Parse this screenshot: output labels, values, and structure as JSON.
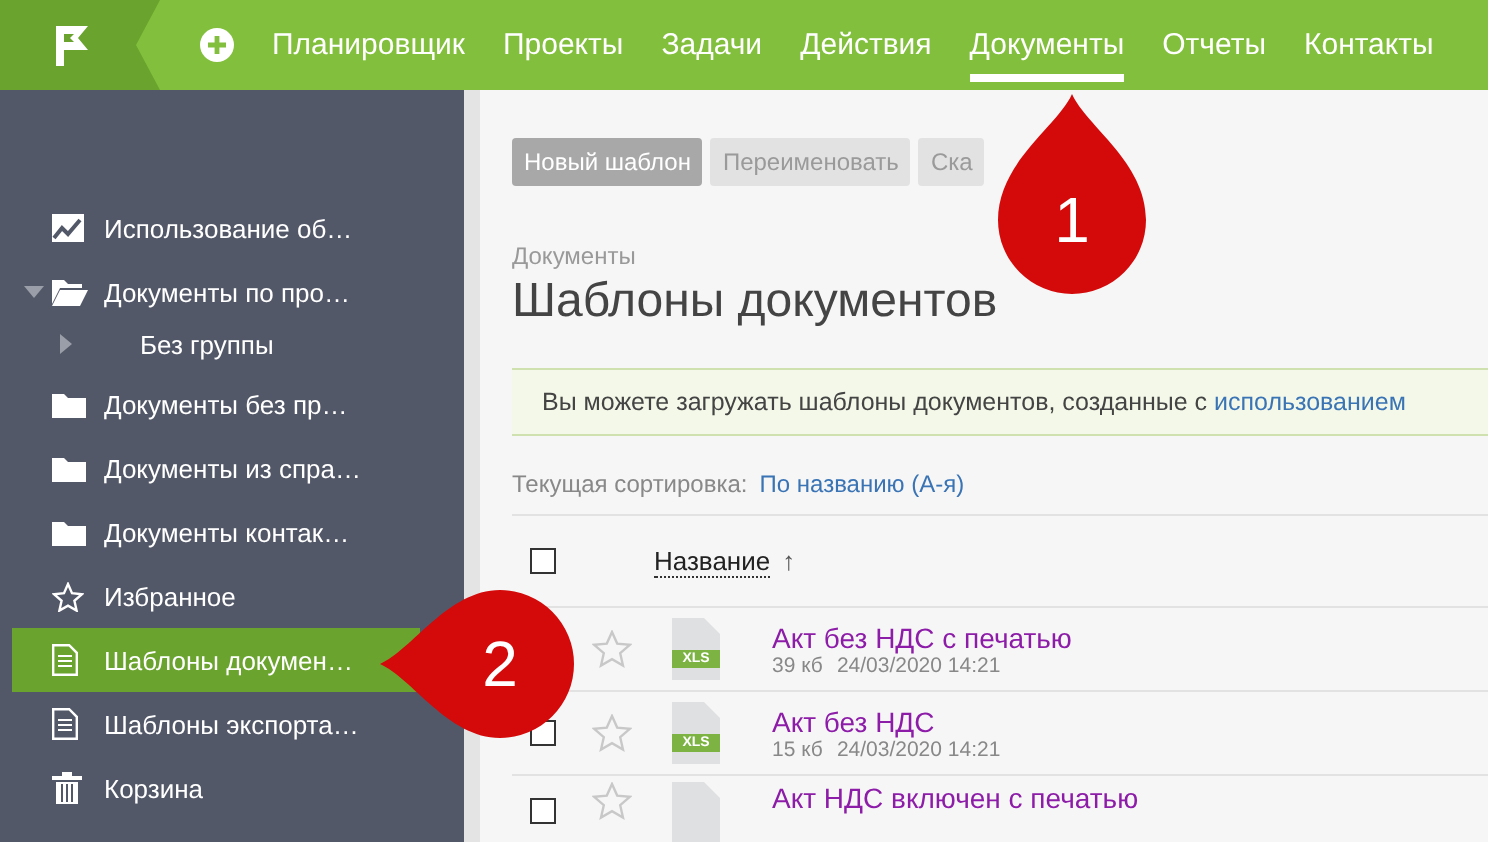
{
  "top_nav": {
    "items": [
      {
        "label": "Планировщик",
        "selected": false
      },
      {
        "label": "Проекты",
        "selected": false
      },
      {
        "label": "Задачи",
        "selected": false
      },
      {
        "label": "Действия",
        "selected": false
      },
      {
        "label": "Документы",
        "selected": true
      },
      {
        "label": "Отчеты",
        "selected": false
      },
      {
        "label": "Контакты",
        "selected": false
      }
    ]
  },
  "sidebar": {
    "items": [
      {
        "kind": "chart",
        "label": "Использование об…",
        "selected": false
      },
      {
        "kind": "folder",
        "label": "Документы по про…",
        "selected": false,
        "expanded": true,
        "children": [
          {
            "label": "Без группы",
            "selected": false,
            "expanded": false
          }
        ]
      },
      {
        "kind": "folder",
        "label": "Документы без пр…",
        "selected": false
      },
      {
        "kind": "folder",
        "label": "Документы из спра…",
        "selected": false
      },
      {
        "kind": "folder",
        "label": "Документы контак…",
        "selected": false
      },
      {
        "kind": "star",
        "label": "Избранное",
        "selected": false
      },
      {
        "kind": "doc",
        "label": "Шаблоны докумен…",
        "selected": true
      },
      {
        "kind": "doc",
        "label": "Шаблоны экспорта…",
        "selected": false
      },
      {
        "kind": "trash",
        "label": "Корзина",
        "selected": false
      }
    ]
  },
  "toolbar": {
    "buttons": [
      {
        "label": "Новый шаблон",
        "disabled": false
      },
      {
        "label": "Переименовать",
        "disabled": true
      },
      {
        "label": "Ска",
        "disabled": true
      }
    ]
  },
  "breadcrumb": "Документы",
  "title": "Шаблоны документов",
  "banner": {
    "text": "Вы можете загружать шаблоны документов, созданные с",
    "link": "использованием"
  },
  "sorting": {
    "label": "Текущая сортировка:",
    "value": "По названию (А-я)"
  },
  "table": {
    "header": {
      "checked": false,
      "column": "Название",
      "sort": "↑"
    },
    "rows": [
      {
        "title": "Акт без НДС с печатью",
        "type": "XLS",
        "size": "39 кб",
        "date": "24/03/2020 14:21",
        "favorite": false
      },
      {
        "title": "Акт без НДС",
        "type": "XLS",
        "size": "15 кб",
        "date": "24/03/2020 14:21",
        "checked": false,
        "favorite": false
      },
      {
        "title": "Акт НДС включен с печатью",
        "checked": false,
        "favorite": false
      }
    ]
  },
  "callouts": [
    {
      "number": "1"
    },
    {
      "number": "2"
    }
  ]
}
